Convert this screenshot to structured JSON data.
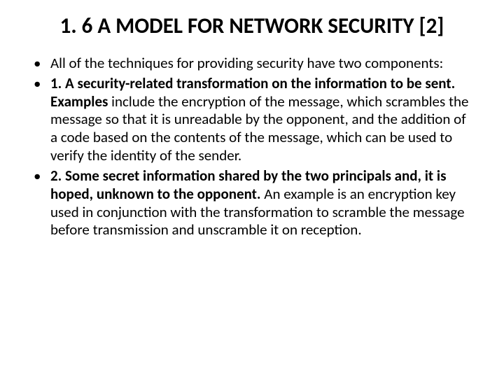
{
  "title": "1. 6 A MODEL FOR NETWORK SECURITY [2]",
  "bullets": {
    "b0": "All of the techniques for providing security have two components:",
    "b1_bold": "1. A security-related transformation on the information to be sent. Examples",
    "b1_rest": " include the encryption of the message, which scrambles the message so that it is unreadable by the opponent, and the addition of a code based on the contents of the message, which can be used to verify the identity of the sender.",
    "b2_bold": "2. Some secret information shared by the two principals and, it is hoped, unknown to the opponent.",
    "b2_rest": " An example is an encryption key used in conjunction with the transformation to scramble the message before transmission and unscramble it on reception."
  }
}
